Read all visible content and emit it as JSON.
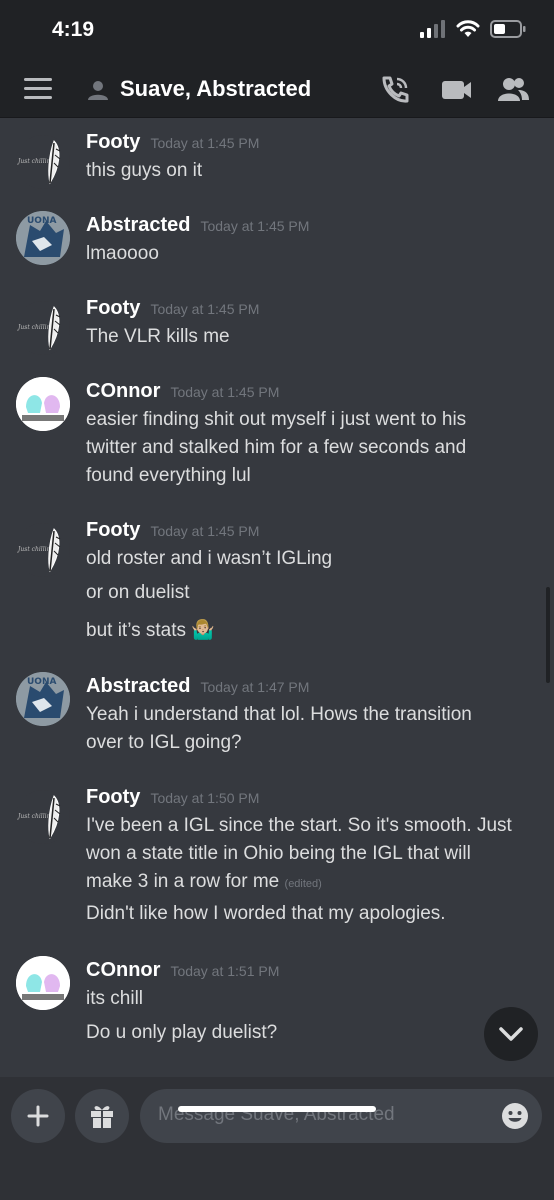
{
  "status": {
    "time": "4:19"
  },
  "header": {
    "title": "Suave, Abstracted",
    "input_placeholder": "Message Suave, Abstracted"
  },
  "messages": [
    {
      "author": "Footy",
      "time": "Today at 1:45 PM",
      "lines": [
        "this guys on it"
      ]
    },
    {
      "author": "Abstracted",
      "time": "Today at 1:45 PM",
      "lines": [
        "lmaoooo"
      ]
    },
    {
      "author": "Footy",
      "time": "Today at 1:45 PM",
      "lines": [
        "The VLR kills me"
      ]
    },
    {
      "author": "COnnor",
      "time": "Today at 1:45 PM",
      "lines": [
        "easier finding shit out myself i just went to his",
        "twitter and stalked him for a few seconds and",
        "found everything lul"
      ]
    },
    {
      "author": "Footy",
      "time": "Today at 1:45 PM",
      "lines": [
        "old roster and i wasn’t IGLing",
        "or on duelist",
        "but it’s stats 🤷🏼‍♂️"
      ]
    },
    {
      "author": "Abstracted",
      "time": "Today at 1:47 PM",
      "lines": [
        "Yeah i understand that lol. Hows the transition",
        "over to IGL going?"
      ]
    },
    {
      "author": "Footy",
      "time": "Today at 1:50 PM",
      "lines": [
        "I've been a IGL since the start. So it's smooth. Just",
        "won a state title in Ohio being the IGL that will",
        "make 3 in a row for me"
      ],
      "edited_label": "(edited)",
      "extra_lines": [
        "Didn't like how I worded that my apologies."
      ]
    },
    {
      "author": "COnnor",
      "time": "Today at 1:51 PM",
      "lines": [
        "its chill",
        "Do u only play duelist?"
      ]
    }
  ],
  "avatars": {
    "footy_caption": "Just chillin'"
  },
  "colors": {
    "background": "#36393f",
    "header": "#202225",
    "composer": "#2f3136",
    "input": "#40444b",
    "muted": "#72767d"
  }
}
